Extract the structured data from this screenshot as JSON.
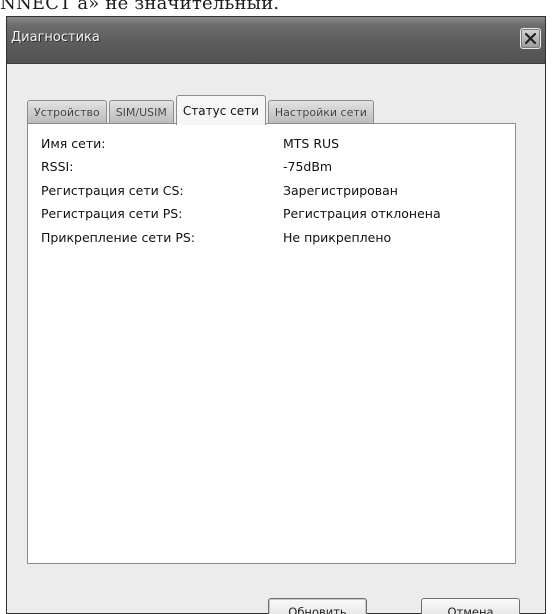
{
  "page": {
    "top_text": "NNECT a» не значительный."
  },
  "window": {
    "title": "Диагностика"
  },
  "tabs": [
    {
      "label": "Устройство",
      "active": false
    },
    {
      "label": "SIM/USIM",
      "active": false
    },
    {
      "label": "Статус сети",
      "active": true
    },
    {
      "label": "Настройки сети",
      "active": false
    }
  ],
  "network_status": {
    "rows": [
      {
        "label": "Имя сети:",
        "value": "MTS RUS"
      },
      {
        "label": "RSSI:",
        "value": "-75dBm"
      },
      {
        "label": "Регистрация сети CS:",
        "value": "Зарегистрирован"
      },
      {
        "label": "Регистрация сети PS:",
        "value": "Регистрация отклонена"
      },
      {
        "label": "Прикрепление сети PS:",
        "value": "Не прикреплено"
      }
    ]
  },
  "buttons": {
    "refresh_label": "Обновить",
    "cancel_label": "Отмена"
  },
  "colors": {
    "titlebar": "#5d5d5d",
    "dialog_background": "#ececec",
    "panel_background": "#ffffff"
  }
}
